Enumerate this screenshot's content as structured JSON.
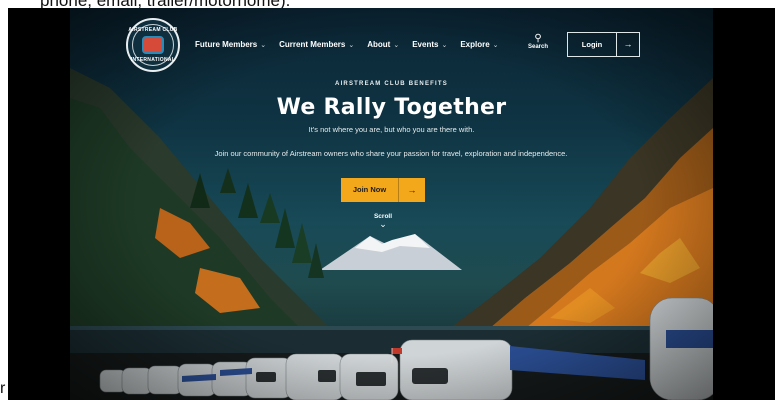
{
  "page_fragment": {
    "top_text": "phone, email, trailer/motorhome).",
    "left_stray": "r"
  },
  "nav": {
    "logo_top": "AIRSTREAM CLUB",
    "logo_bottom": "INTERNATIONAL",
    "items": [
      {
        "label": "Future Members",
        "chevron": "⌄"
      },
      {
        "label": "Current Members",
        "chevron": "⌄"
      },
      {
        "label": "About",
        "chevron": "⌄"
      },
      {
        "label": "Events",
        "chevron": "⌄"
      },
      {
        "label": "Explore",
        "chevron": "⌄"
      }
    ],
    "search_label": "Search",
    "login_label": "Login",
    "login_arrow": "→"
  },
  "hero": {
    "eyebrow": "AIRSTREAM CLUB BENEFITS",
    "title": "We Rally Together",
    "subtitle": "It's not where you are, but who you are there with.",
    "description": "Join our community of Airstream owners who share your passion for travel, exploration and independence.",
    "cta_label": "Join Now",
    "cta_arrow": "→",
    "scroll_label": "Scroll",
    "scroll_chevron": "⌄"
  },
  "colors": {
    "accent": "#f3a81c",
    "sky": "#0f3443",
    "foliage": "#d4781e"
  }
}
